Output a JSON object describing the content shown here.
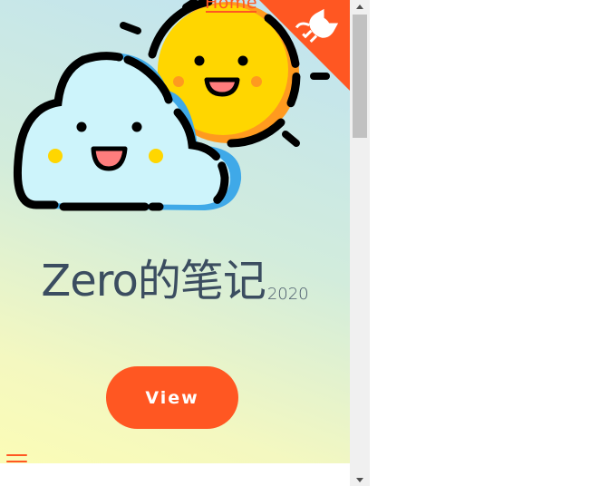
{
  "nav": {
    "home_label": "Home"
  },
  "hero": {
    "title": "Zero的笔记",
    "version": "2020",
    "view_button_label": "View"
  },
  "colors": {
    "accent": "#ff5722",
    "title_text": "#34495e",
    "sun": "#ffd600",
    "sun_rim": "#ff9a1f",
    "cloud": "#cdf4fb",
    "cloud_shade": "#3fa9e8"
  },
  "icons": {
    "github_corner": "github-cat-icon",
    "menu": "hamburger-icon",
    "scroll_up": "triangle-up-icon",
    "scroll_down": "triangle-down-icon"
  }
}
